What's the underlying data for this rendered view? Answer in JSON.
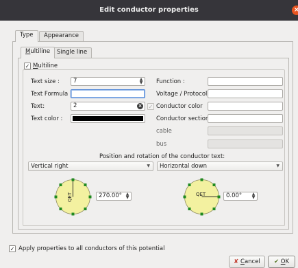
{
  "window": {
    "title": "Edit conductor properties",
    "close_glyph": "×"
  },
  "tabs": {
    "type": "Type",
    "appearance": "Appearance"
  },
  "subtabs": {
    "multiline": {
      "mnemonic": "M",
      "rest": "ultiline"
    },
    "single_line": "Single line"
  },
  "multiline_group": {
    "check_mnemonic": "M",
    "check_rest": "ultiline",
    "checked": true
  },
  "left_fields": {
    "text_size_label": "Text size :",
    "text_size_value": "7",
    "text_formula_label": "Text Formula :",
    "text_formula_value": "",
    "text_label": "Text:",
    "text_value": "2",
    "text_color_label": "Text color :",
    "text_color": "#000000"
  },
  "right_fields": {
    "function_label": "Function :",
    "function_value": "",
    "voltage_label": "Voltage / Protocol :",
    "voltage_value": "",
    "conductor_color_label": "Conductor color",
    "conductor_color_value": "",
    "conductor_section_label": "Conductor section",
    "conductor_section_value": "",
    "cable_label": "cable",
    "cable_value": "",
    "bus_label": "bus",
    "bus_value": ""
  },
  "rotation": {
    "heading": "Position and rotation of the conductor text:",
    "vertical_option": "Vertical right",
    "horizontal_option": "Horizontal down",
    "vertical_angle": "270.00°",
    "horizontal_angle": "0.00°",
    "dial_text": "QET",
    "dial_color": "#f3f1a0",
    "dial_dot_color": "#1f8a1f"
  },
  "footer": {
    "apply_all_label": "Apply properties to all conductors of this potential",
    "apply_all_checked": true,
    "cancel_mnemonic": "C",
    "cancel_rest": "ancel",
    "ok_mnemonic": "O",
    "ok_rest": "K"
  },
  "icons": {
    "check": "✓",
    "clear": "×",
    "spin_up": "▲",
    "spin_down": "▼",
    "combo_arrow": "▼",
    "cancel_icon": "✘",
    "ok_icon": "✔"
  },
  "accent_color": "#e95420"
}
